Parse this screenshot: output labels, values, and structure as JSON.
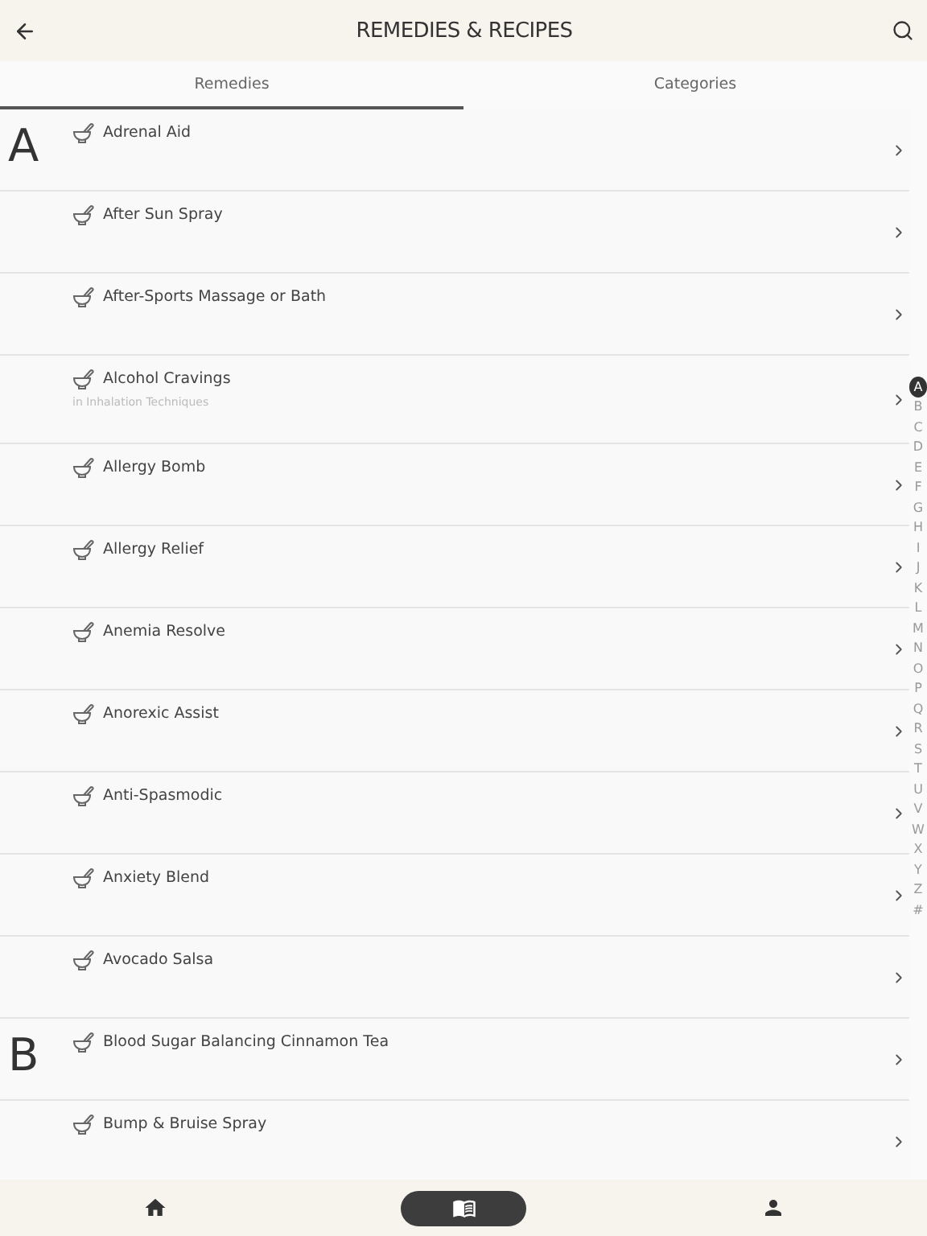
{
  "header": {
    "title": "REMEDIES & RECIPES"
  },
  "tabs": [
    {
      "label": "Remedies",
      "selected": true
    },
    {
      "label": "Categories",
      "selected": false
    }
  ],
  "rows": [
    {
      "letter": "A",
      "title": "Adrenal Aid"
    },
    {
      "title": "After Sun Spray"
    },
    {
      "title": "After-Sports Massage or Bath"
    },
    {
      "title": "Alcohol Cravings",
      "subtitle": "in  Inhalation Techniques"
    },
    {
      "title": "Allergy Bomb"
    },
    {
      "title": "Allergy Relief"
    },
    {
      "title": "Anemia Resolve"
    },
    {
      "title": "Anorexic Assist"
    },
    {
      "title": "Anti-Spasmodic"
    },
    {
      "title": "Anxiety Blend"
    },
    {
      "title": "Avocado Salsa"
    },
    {
      "letter": "B",
      "title": "Blood Sugar Balancing Cinnamon Tea"
    },
    {
      "title": "Bump & Bruise Spray"
    }
  ],
  "index": [
    {
      "label": "A",
      "selected": true
    },
    {
      "label": "B",
      "selected": false
    },
    {
      "label": "C",
      "selected": false
    },
    {
      "label": "D",
      "selected": false
    },
    {
      "label": "E",
      "selected": false
    },
    {
      "label": "F",
      "selected": false
    },
    {
      "label": "G",
      "selected": false
    },
    {
      "label": "H",
      "selected": false
    },
    {
      "label": "I",
      "selected": false
    },
    {
      "label": "J",
      "selected": false
    },
    {
      "label": "K",
      "selected": false
    },
    {
      "label": "L",
      "selected": false
    },
    {
      "label": "M",
      "selected": false
    },
    {
      "label": "N",
      "selected": false
    },
    {
      "label": "O",
      "selected": false
    },
    {
      "label": "P",
      "selected": false
    },
    {
      "label": "Q",
      "selected": false
    },
    {
      "label": "R",
      "selected": false
    },
    {
      "label": "S",
      "selected": false
    },
    {
      "label": "T",
      "selected": false
    },
    {
      "label": "U",
      "selected": false
    },
    {
      "label": "V",
      "selected": false
    },
    {
      "label": "W",
      "selected": false
    },
    {
      "label": "X",
      "selected": false
    },
    {
      "label": "Y",
      "selected": false
    },
    {
      "label": "Z",
      "selected": false
    },
    {
      "label": "#",
      "selected": false
    }
  ],
  "nav": [
    {
      "kind": "home",
      "selected": false
    },
    {
      "kind": "book",
      "selected": true
    },
    {
      "kind": "profile",
      "selected": false
    }
  ]
}
